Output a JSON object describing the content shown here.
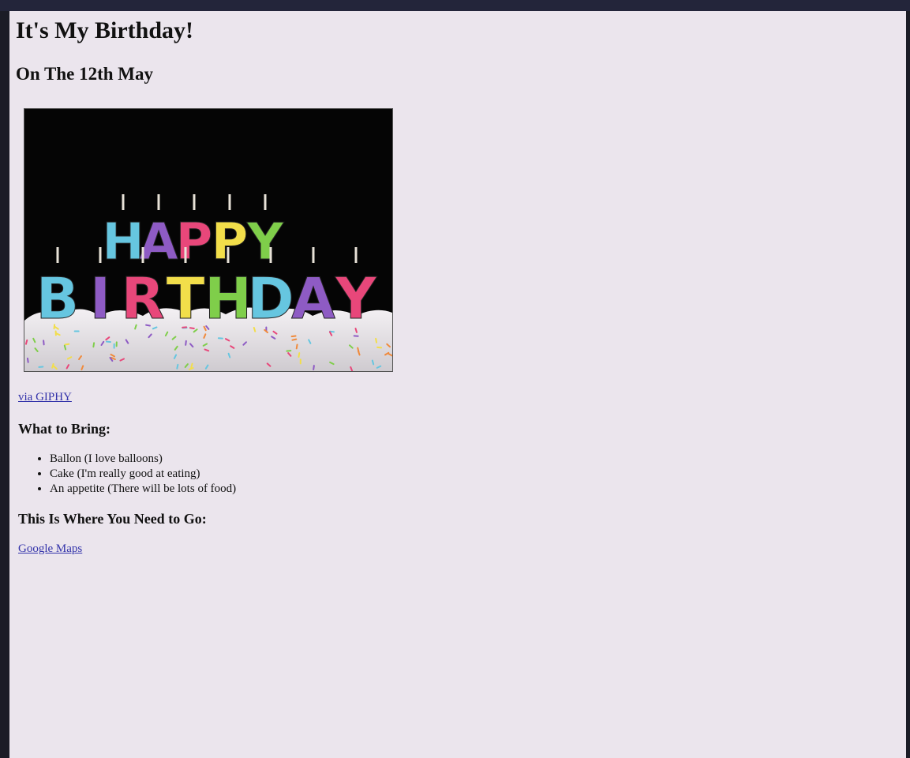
{
  "page": {
    "title": "It's My Birthday!",
    "date": "On The 12th May"
  },
  "gif": {
    "alt": "HAPPY BIRTHDAY",
    "credit_link": "via GIPHY",
    "letter_colors": [
      "#66c6e0",
      "#8e5bc4",
      "#e8477a",
      "#f2de4a",
      "#7fce4a"
    ]
  },
  "bring": {
    "heading": "What to Bring:",
    "items": [
      "Ballon (I love balloons)",
      "Cake (I'm really good at eating)",
      "An appetite (There will be lots of food)"
    ]
  },
  "directions": {
    "heading": "This Is Where You Need to Go:",
    "link": "Google Maps"
  }
}
